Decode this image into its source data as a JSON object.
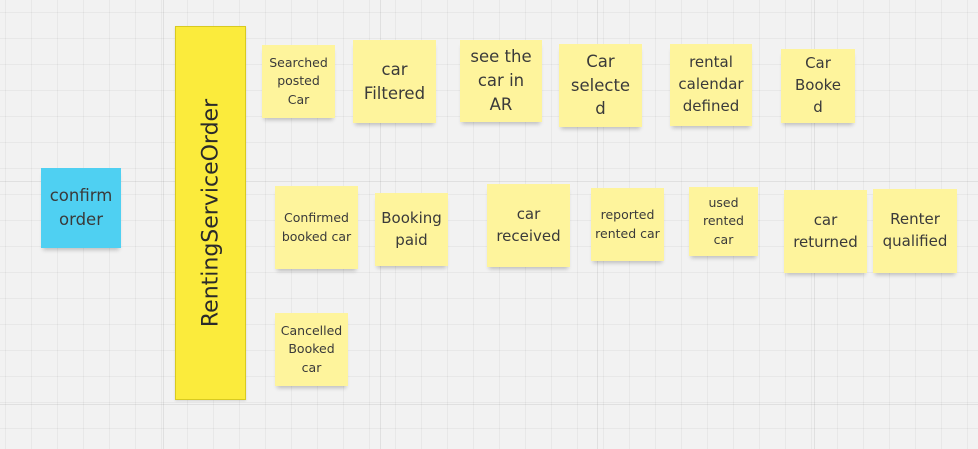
{
  "board": {
    "aggregate": {
      "label": "RentingServiceOrder"
    },
    "command": {
      "label": "confirm order"
    },
    "events_row1": [
      {
        "label": "Searched posted Car"
      },
      {
        "label": "car Filtered"
      },
      {
        "label": "see the car in AR"
      },
      {
        "label": "Car selected"
      },
      {
        "label": "rental calendar defined"
      },
      {
        "label": "Car Booked"
      }
    ],
    "events_row2": [
      {
        "label": "Confirmed booked car"
      },
      {
        "label": "Booking paid"
      },
      {
        "label": "car received"
      },
      {
        "label": "reported rented car"
      },
      {
        "label": "used rented car"
      },
      {
        "label": "car returned"
      },
      {
        "label": "Renter qualified"
      }
    ],
    "events_row3": [
      {
        "label": "Cancelled Booked car"
      }
    ]
  },
  "colors": {
    "event_sticky": "#fef49c",
    "command_sticky": "#4fd0f2",
    "aggregate_sticky": "#fbeb3c",
    "canvas": "#f2f2f2"
  }
}
